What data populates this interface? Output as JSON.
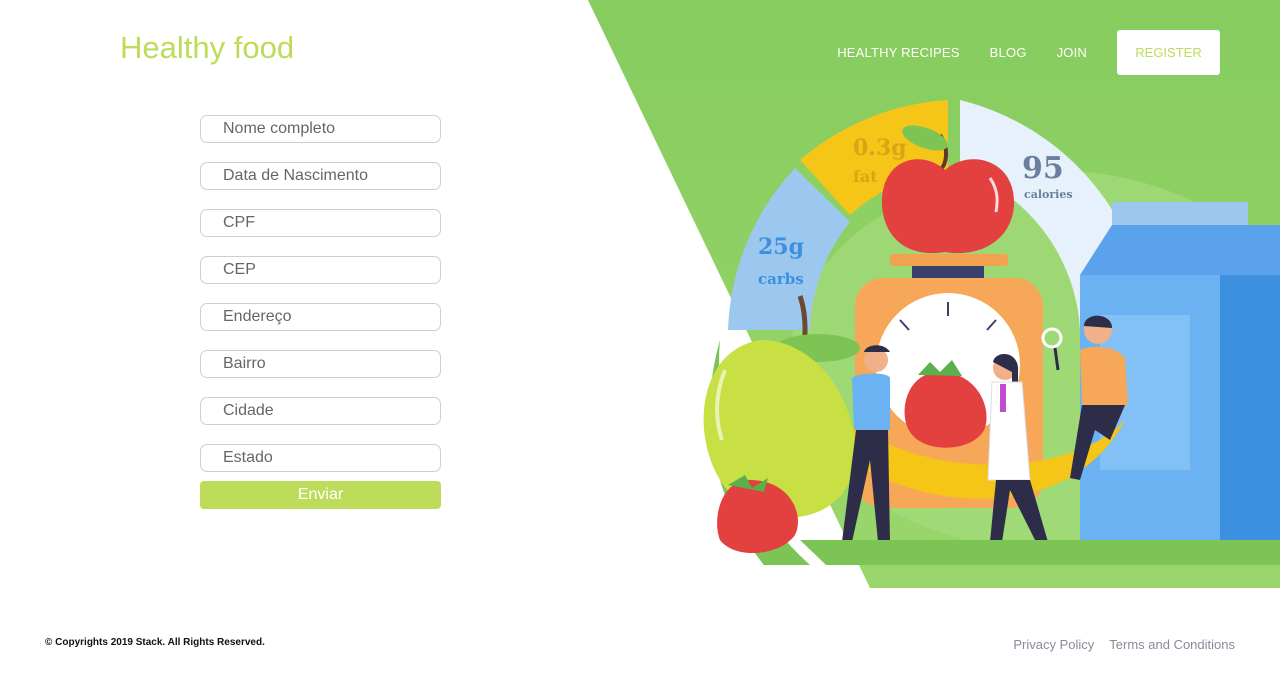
{
  "brand": {
    "logo": "Healthy food"
  },
  "nav": {
    "items": [
      "HEALTHY RECIPES",
      "BLOG",
      "JOIN"
    ],
    "register_label": "REGISTER"
  },
  "form": {
    "fields": [
      {
        "placeholder": "Nome completo",
        "value": ""
      },
      {
        "placeholder": "Data de Nascimento",
        "value": ""
      },
      {
        "placeholder": "CPF",
        "value": ""
      },
      {
        "placeholder": "CEP",
        "value": ""
      },
      {
        "placeholder": "Endereço",
        "value": ""
      },
      {
        "placeholder": "Bairro",
        "value": ""
      },
      {
        "placeholder": "Cidade",
        "value": ""
      },
      {
        "placeholder": "Estado",
        "value": ""
      }
    ],
    "submit_label": "Enviar"
  },
  "hero": {
    "fat_value": "0.3g",
    "fat_label": "fat",
    "carbs_value": "25g",
    "carbs_label": "carbs",
    "calories_value": "95",
    "calories_label": "calories"
  },
  "footer": {
    "copyright": "© Copyrights 2019 Stack. All Rights Reserved.",
    "links": [
      "Privacy Policy",
      "Terms and Conditions"
    ]
  },
  "colors": {
    "accent": "#bcdc5a",
    "green": "#8ccf63",
    "fat": "#f5c518",
    "carbs": "#9cc8f0",
    "calories": "#e6f1fb"
  }
}
